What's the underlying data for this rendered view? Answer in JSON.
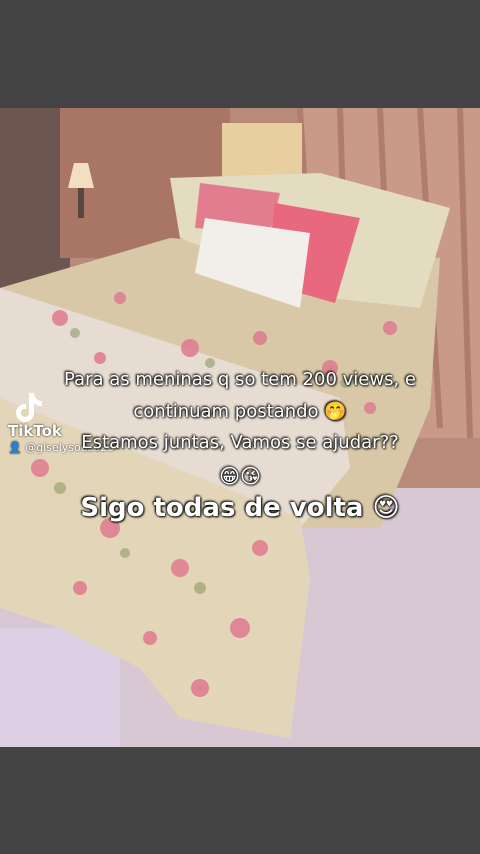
{
  "caption": {
    "line1": "Para as meninas q so tem 200 views, e",
    "line2": "continuam postando 🤭",
    "line3": "Estamos juntas, Vamos se ajudar??",
    "line4": "😁😘",
    "line5": "Sigo todas de volta 😍"
  },
  "watermark": {
    "brand": "TikTok",
    "username": "@giselysouza23"
  },
  "colors": {
    "band": "#444444",
    "wall": "#c79a87",
    "bedspread": "#d8c8a8",
    "floral_pink": "#e07a8f",
    "throw": "#e9e3dc",
    "floor": "#d9c9d4"
  }
}
